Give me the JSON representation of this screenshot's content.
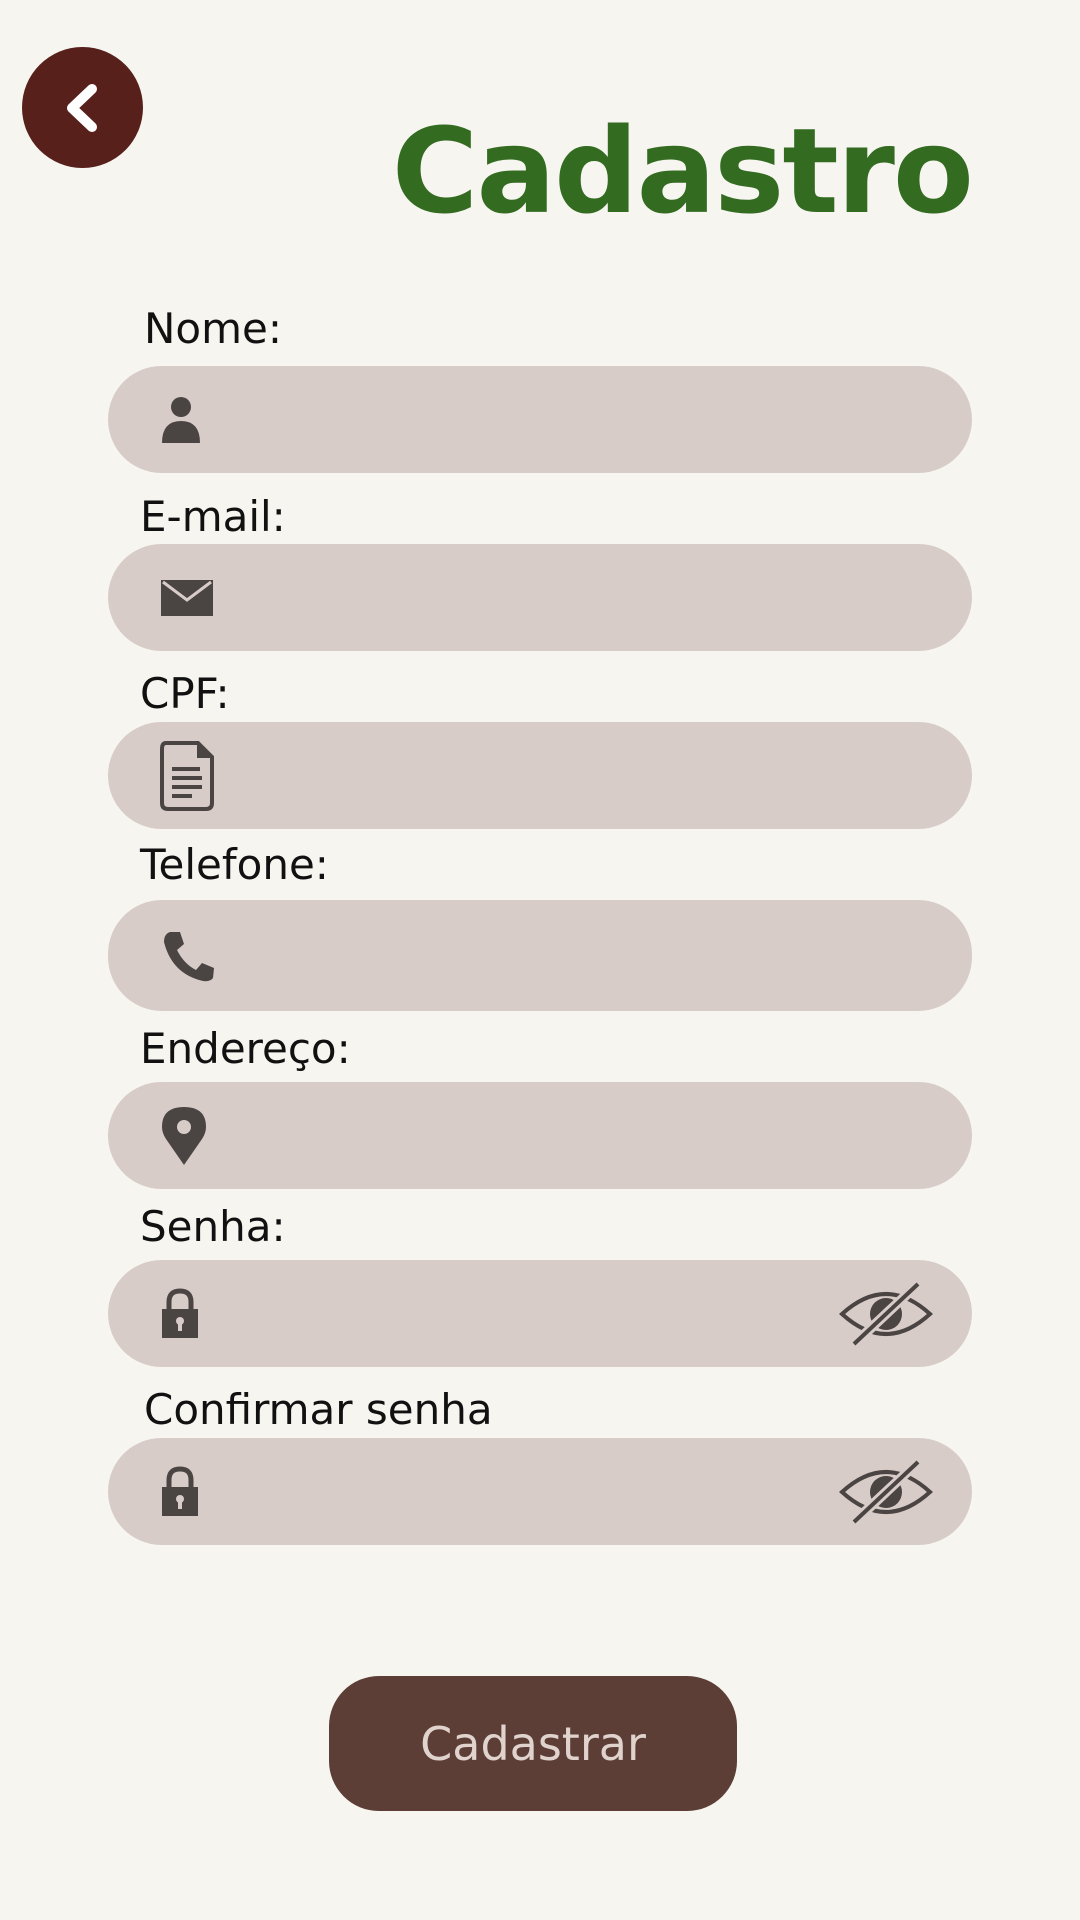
{
  "header": {
    "title": "Cadastro",
    "back_icon": "chevron-left-icon"
  },
  "form": {
    "fields": [
      {
        "label": "Nome:",
        "icon": "user-icon",
        "value": ""
      },
      {
        "label": "E-mail:",
        "icon": "envelope-icon",
        "value": ""
      },
      {
        "label": "CPF:",
        "icon": "document-icon",
        "value": ""
      },
      {
        "label": "Telefone:",
        "icon": "phone-icon",
        "value": ""
      },
      {
        "label": "Endereço:",
        "icon": "map-pin-icon",
        "value": ""
      },
      {
        "label": "Senha:",
        "icon": "lock-icon",
        "value": "",
        "toggle_icon": "eye-slash-icon"
      },
      {
        "label": "Confirmar senha",
        "icon": "lock-icon",
        "value": "",
        "toggle_icon": "eye-slash-icon"
      }
    ],
    "submit_label": "Cadastrar"
  },
  "colors": {
    "background": "#f7f5f0",
    "title": "#336b21",
    "back_button": "#57201b",
    "field_background": "#d8ccc8",
    "icon": "#4a4443",
    "submit_background": "#5c3e36",
    "submit_text": "#e0d3cd"
  }
}
